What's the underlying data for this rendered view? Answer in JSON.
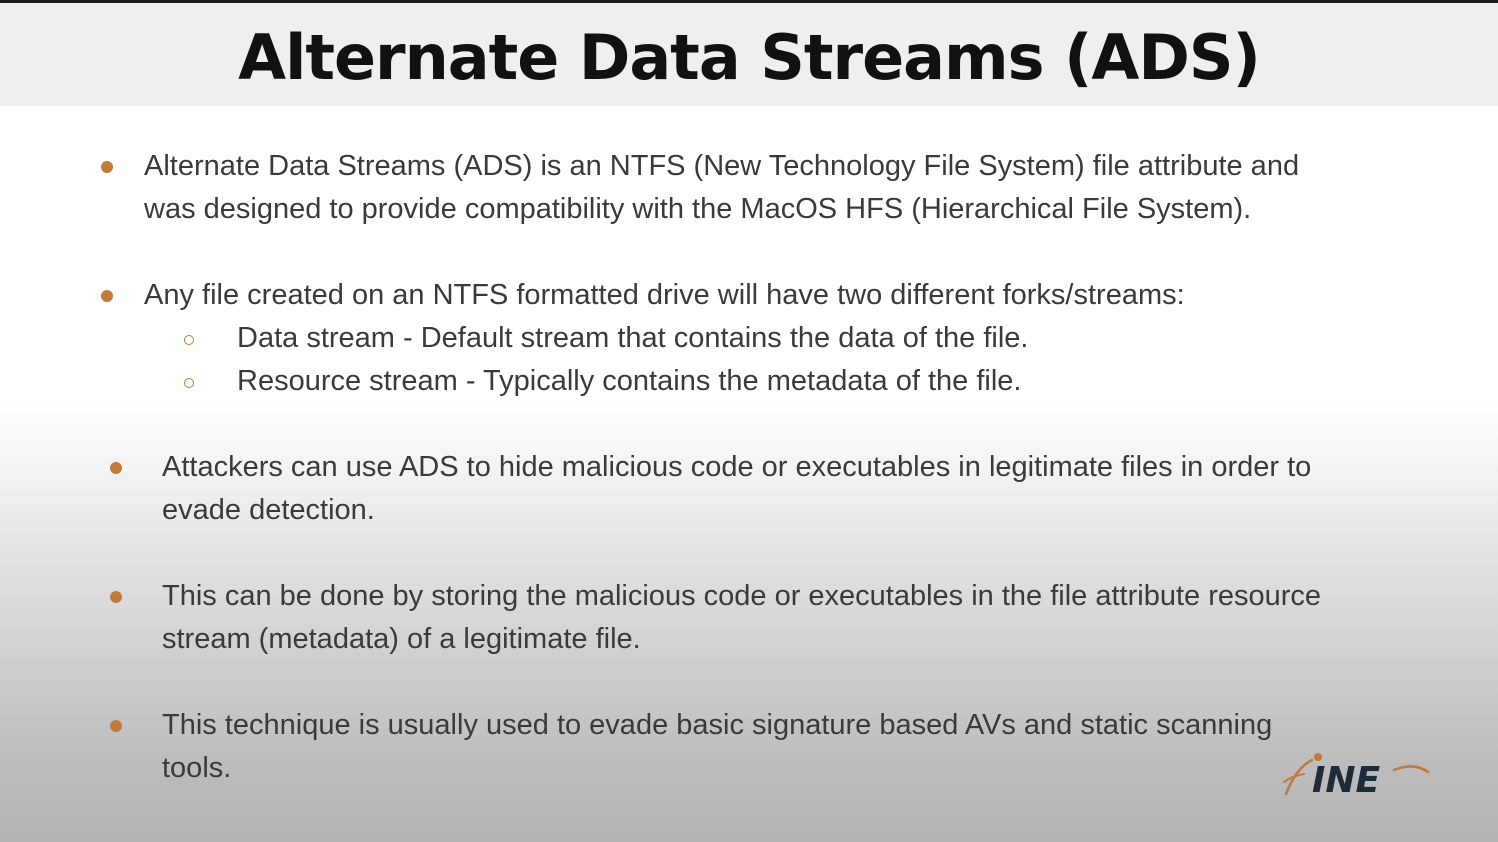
{
  "title": "Alternate Data Streams (ADS)",
  "bullets": [
    {
      "lines": [
        "Alternate Data Streams (ADS) is an NTFS (New Technology File System) file attribute and",
        "was designed to provide compatibility with the MacOS HFS (Hierarchical File System)."
      ]
    },
    {
      "lines": [
        "Any file created on an NTFS formatted drive will have two different forks/streams:"
      ],
      "sub_items": [
        "Data stream - Default stream that contains the data of the file.",
        "Resource stream - Typically contains the metadata of the file."
      ]
    },
    {
      "lines": [
        "Attackers can use ADS to hide malicious code or executables in legitimate files in order to",
        "evade detection."
      ]
    },
    {
      "lines": [
        "This can be done by storing the malicious code or executables in the file attribute resource",
        "stream (metadata) of a legitimate file."
      ]
    },
    {
      "lines": [
        "This technique is usually used to evade basic signature based AVs and static scanning",
        "tools."
      ]
    }
  ],
  "logo": {
    "text": "INE"
  },
  "colors": {
    "accent": "#c07a3a",
    "title": "#111111",
    "body_text": "#3a3a3a"
  }
}
